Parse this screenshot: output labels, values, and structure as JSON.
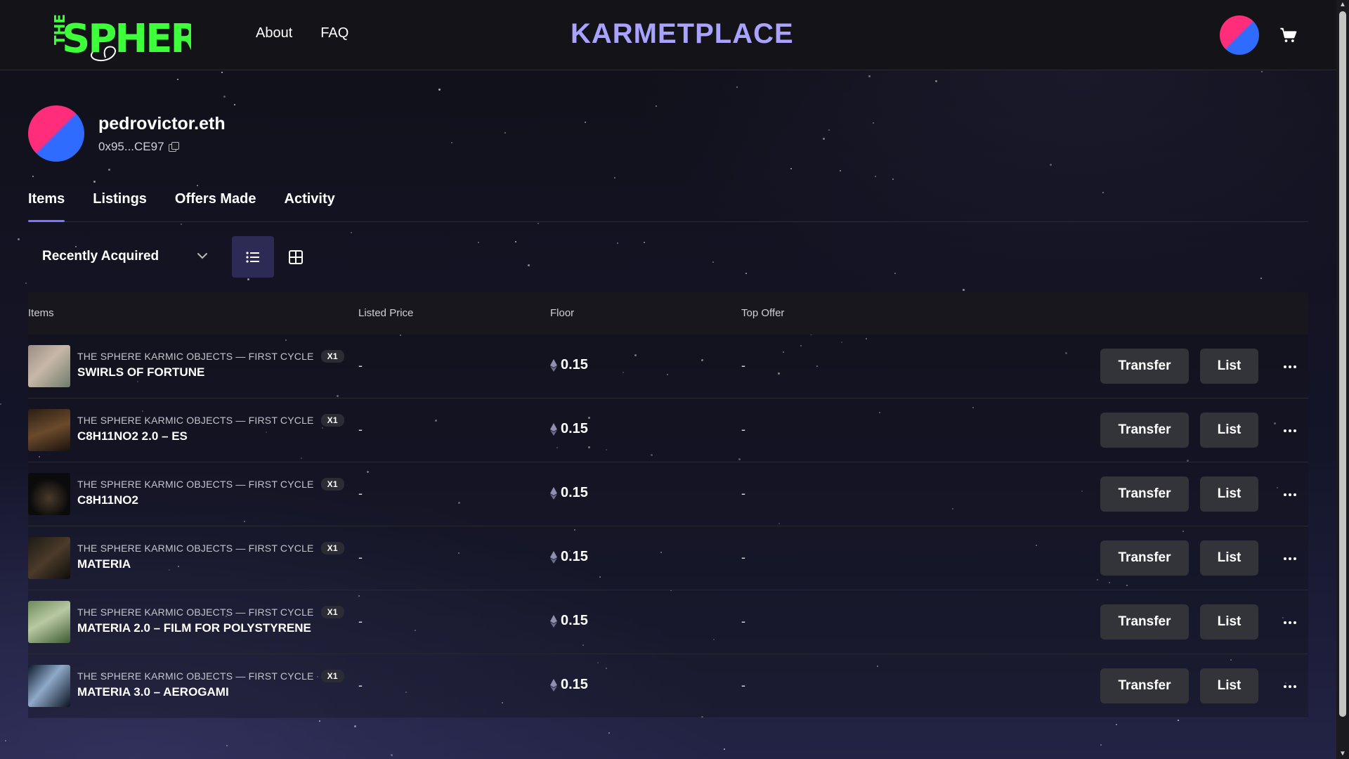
{
  "header": {
    "logo_alt": "THE SPHERE",
    "nav": [
      {
        "label": "About"
      },
      {
        "label": "FAQ"
      }
    ],
    "brand": "KARMETPLACE"
  },
  "profile": {
    "name": "pedrovictor.eth",
    "address": "0x95...CE97"
  },
  "tabs": [
    {
      "label": "Items",
      "active": true
    },
    {
      "label": "Listings",
      "active": false
    },
    {
      "label": "Offers Made",
      "active": false
    },
    {
      "label": "Activity",
      "active": false
    }
  ],
  "sort": {
    "selected": "Recently Acquired"
  },
  "table": {
    "headers": {
      "items": "Items",
      "listed_price": "Listed Price",
      "floor": "Floor",
      "top_offer": "Top Offer"
    },
    "actions": {
      "transfer": "Transfer",
      "list": "List"
    },
    "rows": [
      {
        "collection": "THE SPHERE KARMIC OBJECTS — FIRST CYCLE",
        "qty": "x1",
        "title": "SWIRLS OF FORTUNE",
        "listed": "-",
        "floor": "0.15",
        "offer": "-"
      },
      {
        "collection": "THE SPHERE KARMIC OBJECTS — FIRST CYCLE",
        "qty": "x1",
        "title": "C8H11NO2 2.0 – ES",
        "listed": "-",
        "floor": "0.15",
        "offer": "-"
      },
      {
        "collection": "THE SPHERE KARMIC OBJECTS — FIRST CYCLE",
        "qty": "x1",
        "title": "C8H11NO2",
        "listed": "-",
        "floor": "0.15",
        "offer": "-"
      },
      {
        "collection": "THE SPHERE KARMIC OBJECTS — FIRST CYCLE",
        "qty": "x1",
        "title": "MATERIA",
        "listed": "-",
        "floor": "0.15",
        "offer": "-"
      },
      {
        "collection": "THE SPHERE KARMIC OBJECTS — FIRST CYCLE",
        "qty": "x1",
        "title": "MATERIA 2.0 – FILM FOR POLYSTYRENE",
        "listed": "-",
        "floor": "0.15",
        "offer": "-"
      },
      {
        "collection": "THE SPHERE KARMIC OBJECTS — FIRST CYCLE",
        "qty": "x1",
        "title": "MATERIA 3.0 – AEROGAMI",
        "listed": "-",
        "floor": "0.15",
        "offer": "-"
      }
    ]
  },
  "colors": {
    "accent": "#7c73ff",
    "brand_text": "#a9a3ff",
    "logo_green": "#3dff3a",
    "button_bg": "#33333a"
  },
  "icons": {
    "cart": "shopping-cart-icon",
    "copy": "copy-icon",
    "list_view": "list-view-icon",
    "grid_view": "grid-view-icon",
    "eth": "ethereum-icon",
    "more": "more-dots-icon"
  }
}
